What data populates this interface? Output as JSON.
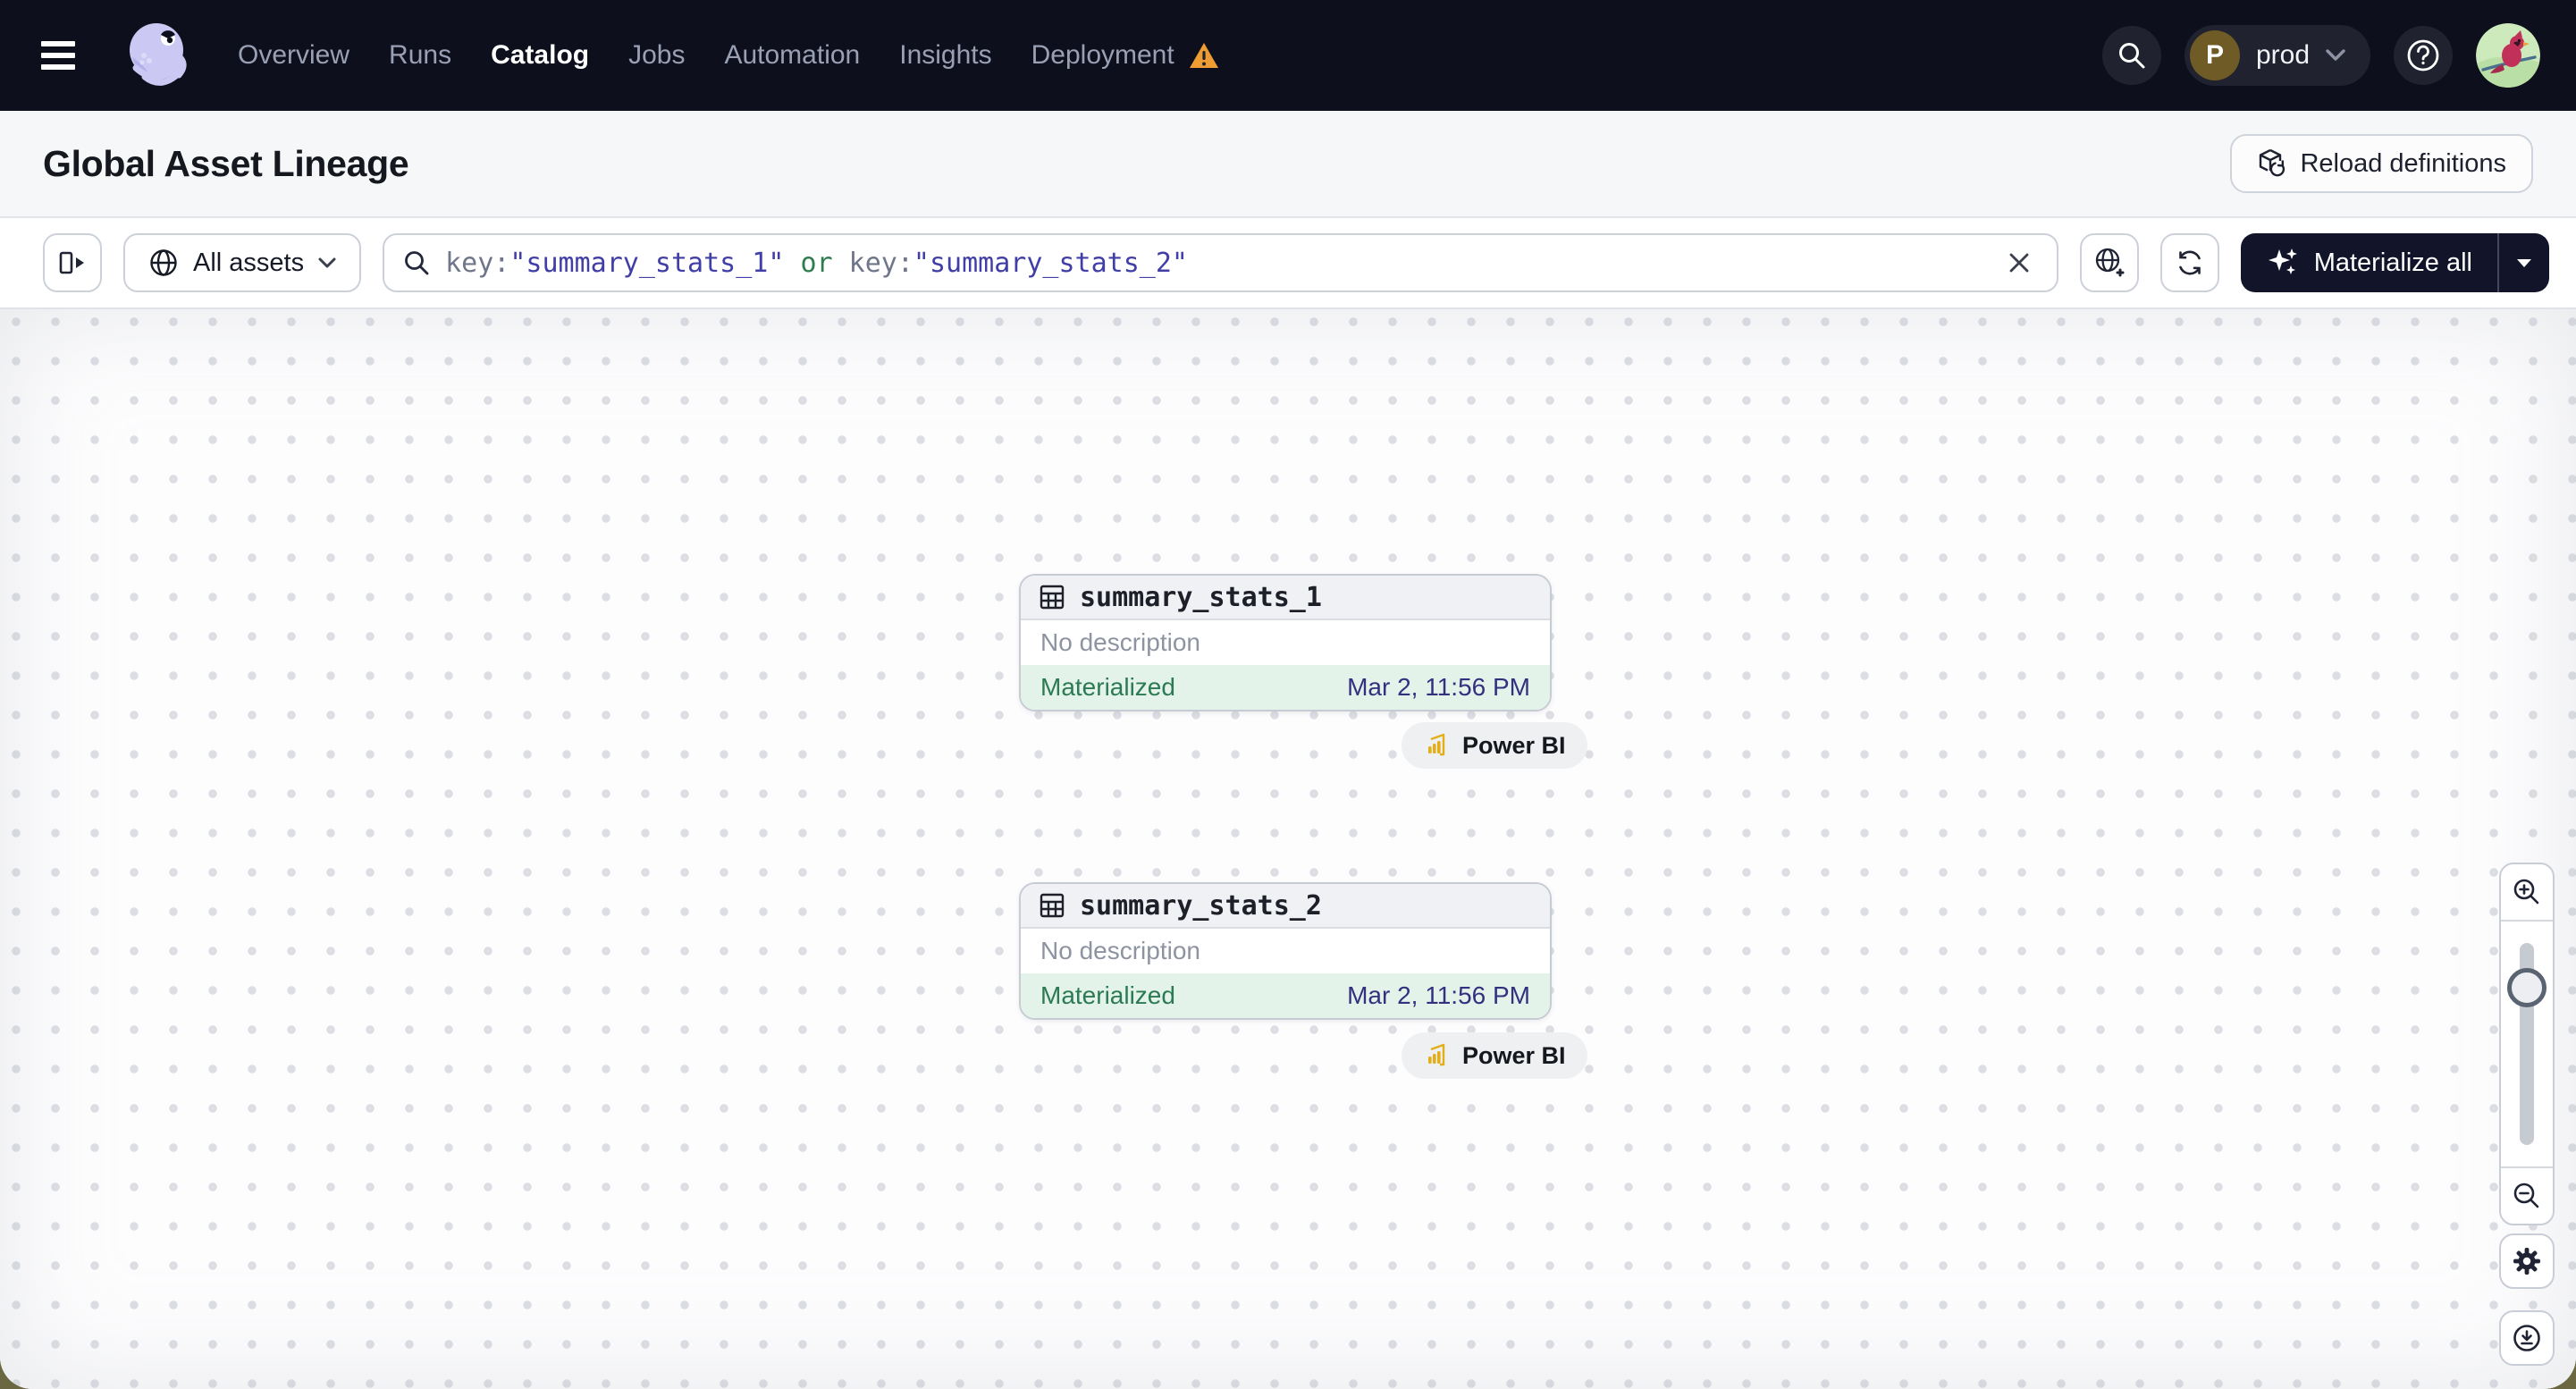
{
  "nav": {
    "items": [
      {
        "label": "Overview"
      },
      {
        "label": "Runs"
      },
      {
        "label": "Catalog"
      },
      {
        "label": "Jobs"
      },
      {
        "label": "Automation"
      },
      {
        "label": "Insights"
      },
      {
        "label": "Deployment"
      }
    ],
    "active_item": "Catalog",
    "deployment_initial": "P",
    "deployment_name": "prod"
  },
  "header": {
    "title": "Global Asset Lineage",
    "reload_button_label": "Reload definitions"
  },
  "toolbar": {
    "scope_label": "All assets",
    "query": {
      "key1": "key:",
      "val1": "\"summary_stats_1\"",
      "op": " or ",
      "key2": "key:",
      "val2": "\"summary_stats_2\""
    },
    "materialize_label": "Materialize all"
  },
  "graph": {
    "nodes": [
      {
        "name": "summary_stats_1",
        "description": "No description",
        "status": "Materialized",
        "materialized_at": "Mar 2, 11:56 PM",
        "tag": "Power BI"
      },
      {
        "name": "summary_stats_2",
        "description": "No description",
        "status": "Materialized",
        "materialized_at": "Mar 2, 11:56 PM",
        "tag": "Power BI"
      }
    ]
  },
  "icons": [
    "hamburger-icon",
    "dagster-logo",
    "warning-icon",
    "search-icon",
    "help-icon",
    "avatar",
    "reload-cube-icon",
    "panel-expand-icon",
    "globe-icon",
    "chevron-down-icon",
    "magnifier-icon",
    "clear-x-icon",
    "globe-add-icon",
    "refresh-icon",
    "sparkle-icon",
    "caret-down-icon",
    "table-icon",
    "powerbi-icon",
    "zoom-in-icon",
    "zoom-out-icon",
    "gear-icon",
    "download-icon"
  ],
  "colors": {
    "nav_bg": "#0d0f1c",
    "accent_green": "#2b7a52",
    "status_bg": "#e4f3ea",
    "timestamp_blue": "#33317f",
    "query_string": "#413fa7",
    "query_operator": "#2e7d4f",
    "warning_orange": "#ef9c33",
    "powerbi_yellow": "#e3af19",
    "materialize_bg": "#12152a"
  }
}
